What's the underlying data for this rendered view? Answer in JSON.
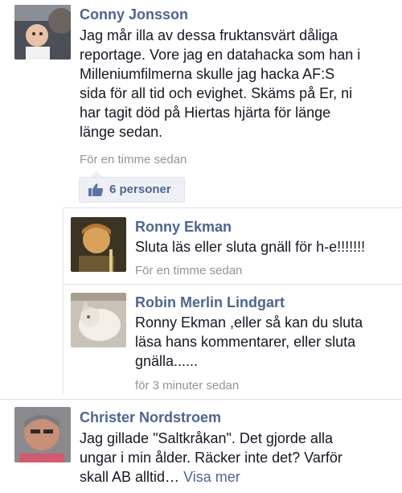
{
  "comments": [
    {
      "author": "Conny Jonsson",
      "lines": [
        "Jag mår illa av dessa fruktansvärt dåliga",
        "reportage. Vore jag en datahacka som han i",
        "Milleniumfilmerna skulle jag hacka AF:S",
        "sida för all tid och evighet. Skäms på Er, ni",
        "har tagit död på Hiertas hjärta för länge",
        "länge sedan."
      ],
      "time": "För en timme sedan",
      "likes": "6 personer"
    },
    {
      "author": "Ronny Ekman",
      "lines": [
        "Sluta läs eller sluta gnäll för h-e!!!!!!!"
      ],
      "time": "För en timme sedan"
    },
    {
      "author": "Robin Merlin Lindgart",
      "lines": [
        "Ronny Ekman ,eller så kan du sluta",
        "läsa hans kommentarer, eller sluta",
        "gnälla......"
      ],
      "time": "för 3 minuter sedan"
    },
    {
      "author": "Christer Nordstroem",
      "lines": [
        "Jag gillade \"Saltkråkan\". Det gjorde alla",
        "ungar i min ålder. Räcker inte det? Varför",
        "skall AB alltid…"
      ],
      "see_more": "Visa mer"
    }
  ],
  "icons": {
    "like": "thumbs-up-icon"
  },
  "colors": {
    "author_name": "#4e6591",
    "timestamp": "#8f949c",
    "like_box_bg": "#eef0f5"
  }
}
